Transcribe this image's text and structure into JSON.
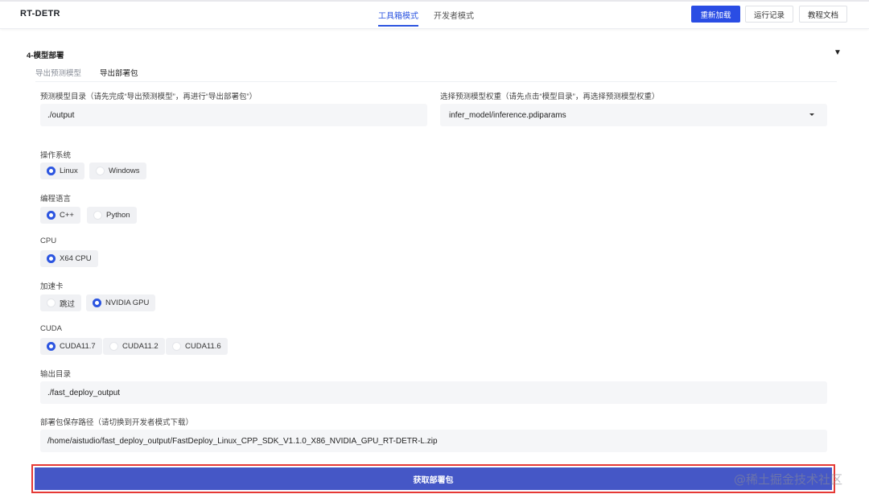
{
  "header": {
    "brand": "RT-DETR",
    "tabs": [
      {
        "label": "工具箱模式",
        "active": true
      },
      {
        "label": "开发者模式",
        "active": false
      }
    ],
    "buttons": {
      "reload": "重新加载",
      "run_log": "运行记录",
      "docs": "教程文档"
    }
  },
  "section": {
    "title": "4-模型部署",
    "collapse_icon": "▼",
    "subtabs": [
      {
        "label": "导出预测模型",
        "active": false
      },
      {
        "label": "导出部署包",
        "active": true
      }
    ]
  },
  "form": {
    "model_dir": {
      "label": "预测模型目录（请先完成“导出预测模型”，再进行“导出部署包”）",
      "value": "./output"
    },
    "model_weights": {
      "label": "选择预测模型权重（请先点击“模型目录”，再选择预测模型权重）",
      "value": "infer_model/inference.pdiparams"
    },
    "os": {
      "label": "操作系统",
      "options": [
        {
          "label": "Linux",
          "selected": true
        },
        {
          "label": "Windows",
          "selected": false
        }
      ]
    },
    "language": {
      "label": "编程语言",
      "options": [
        {
          "label": "C++",
          "selected": true
        },
        {
          "label": "Python",
          "selected": false
        }
      ]
    },
    "cpu": {
      "label": "CPU",
      "options": [
        {
          "label": "X64 CPU",
          "selected": true
        }
      ]
    },
    "accelerator": {
      "label": "加速卡",
      "options": [
        {
          "label": "跳过",
          "selected": false
        },
        {
          "label": "NVIDIA GPU",
          "selected": true
        }
      ]
    },
    "cuda": {
      "label": "CUDA",
      "options": [
        {
          "label": "CUDA11.7",
          "selected": true
        },
        {
          "label": "CUDA11.2",
          "selected": false
        },
        {
          "label": "CUDA11.6",
          "selected": false
        }
      ]
    },
    "output_dir": {
      "label": "输出目录",
      "value": "./fast_deploy_output"
    },
    "package_path": {
      "label": "部署包保存路径（请切换到开发者模式下载）",
      "value": "/home/aistudio/fast_deploy_output/FastDeploy_Linux_CPP_SDK_V1.1.0_X86_NVIDIA_GPU_RT-DETR-L.zip"
    }
  },
  "submit_label": "获取部署包",
  "watermark": "@稀土掘金技术社区",
  "colors": {
    "primary": "#2a4de4",
    "submit": "#4557c6",
    "highlight_frame": "#e53935"
  }
}
